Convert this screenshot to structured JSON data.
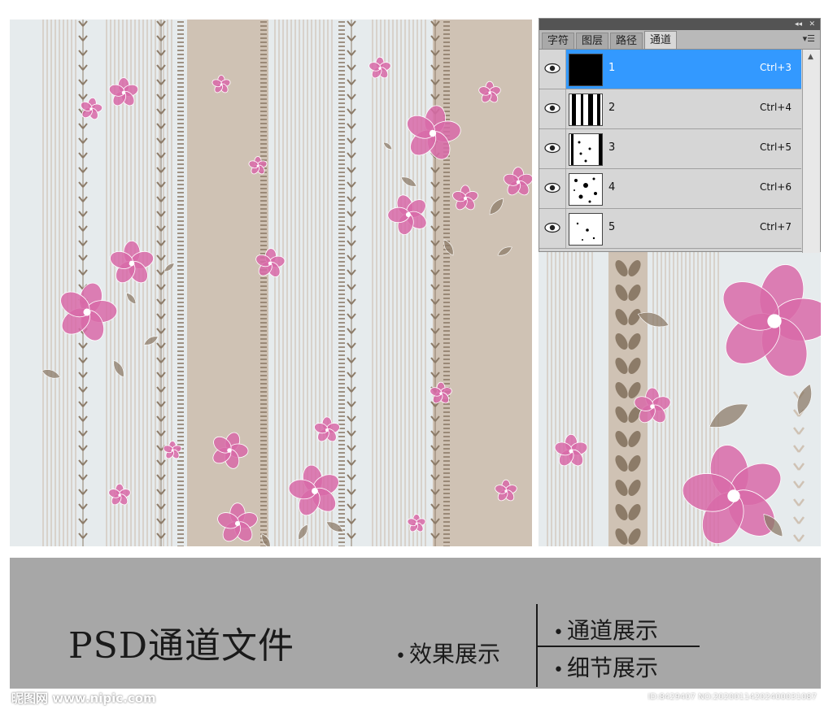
{
  "panel": {
    "tabs": [
      {
        "label": "字符"
      },
      {
        "label": "图层"
      },
      {
        "label": "路径"
      },
      {
        "label": "通道"
      }
    ],
    "active_tab": "通道",
    "titlebar": {
      "collapse": "◂◂",
      "close": "✕"
    },
    "menu_icon": "panel-menu-icon",
    "channels": [
      {
        "name": "1",
        "shortcut": "Ctrl+3",
        "selected": true
      },
      {
        "name": "2",
        "shortcut": "Ctrl+4",
        "selected": false
      },
      {
        "name": "3",
        "shortcut": "Ctrl+5",
        "selected": false
      },
      {
        "name": "4",
        "shortcut": "Ctrl+6",
        "selected": false
      },
      {
        "name": "5",
        "shortcut": "Ctrl+7",
        "selected": false
      }
    ],
    "scroll_up": "▲"
  },
  "banner": {
    "title": "PSD通道文件",
    "effect": "效果展示",
    "channels": "通道展示",
    "detail": "细节展示"
  },
  "footer": {
    "logo": "昵图网 www.nipic.com",
    "id": "ID:8429407 NO:20200114202400031087"
  },
  "colors": {
    "stripe_beige": "#cfc2b4",
    "stripe_light": "#e6ebed",
    "leaf_dark": "#8c7b68",
    "flower_pink": "#d86aa8",
    "selection_blue": "#3399ff",
    "banner_gray": "#a7a7a7"
  }
}
